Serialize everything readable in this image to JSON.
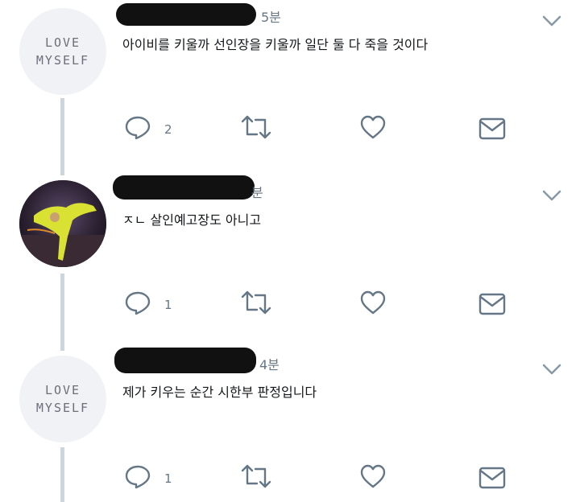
{
  "tweets": [
    {
      "avatar_line1": "LOVE",
      "avatar_line2": "MYSELF",
      "time": "5분",
      "text": "아이비를 키울까 선인장을 키울까 일단 둘 다 죽을 것이다",
      "reply_count": "2"
    },
    {
      "time": "분",
      "text": "ㅈㄴ 살인예고장도 아니고",
      "reply_count": "1"
    },
    {
      "avatar_line1": "LOVE",
      "avatar_line2": "MYSELF",
      "time": "4분",
      "text": "제가 키우는 순간 시한부 판정입니다",
      "reply_count": "1"
    }
  ],
  "icons": {
    "more": "chevron-down-icon",
    "reply": "reply-icon",
    "retweet": "retweet-icon",
    "like": "heart-icon",
    "dm": "mail-icon"
  },
  "colors": {
    "icon": "#657786",
    "thread_line": "#ccd6dd",
    "text": "#14171a"
  }
}
